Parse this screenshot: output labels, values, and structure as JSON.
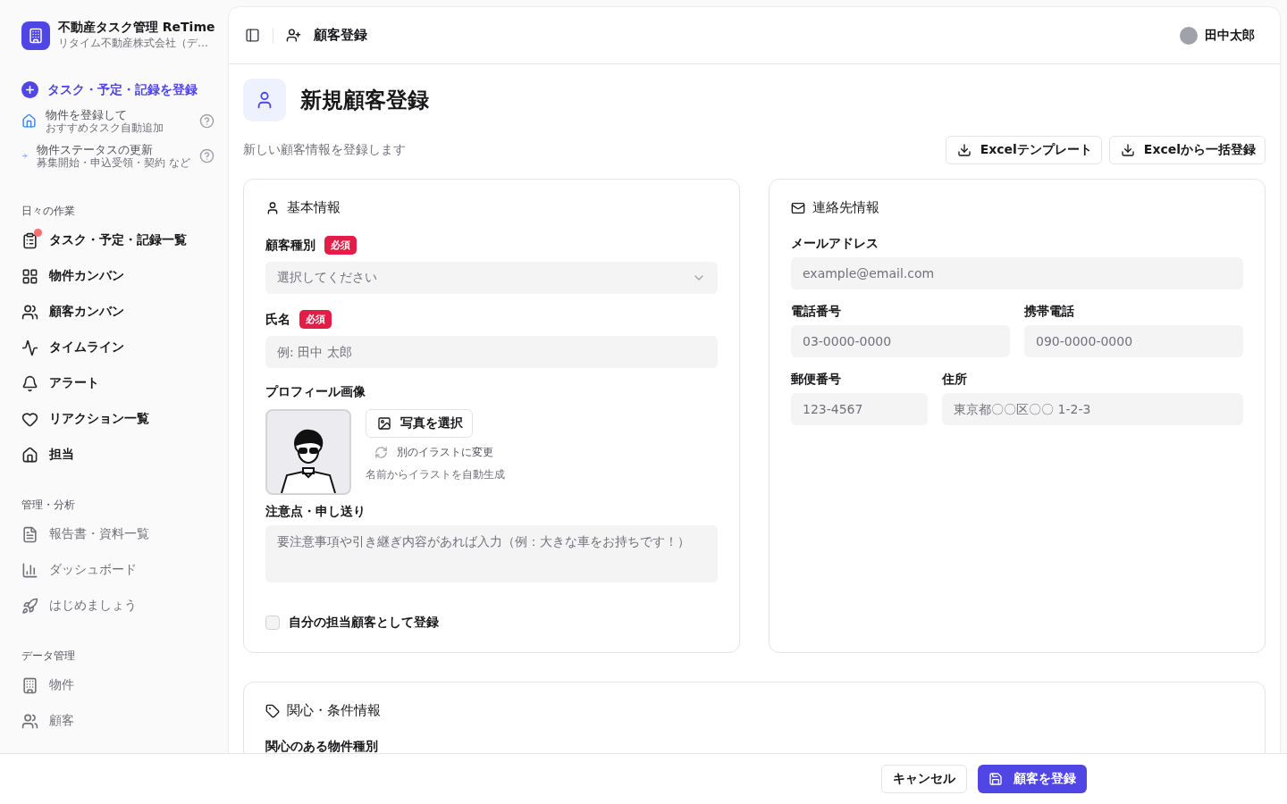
{
  "app": {
    "title": "不動産タスク管理 ReTime",
    "subtitle": "リタイム不動産株式会社（デ…"
  },
  "quick_actions": [
    {
      "kind": "primary",
      "label": "タスク・予定・記録を登録"
    },
    {
      "kind": "hint",
      "label": "物件を登録して",
      "sub": "おすすめタスク自動追加"
    },
    {
      "kind": "hint",
      "label": "物件ステータスの更新",
      "sub": "募集開始・申込受領・契約 など"
    }
  ],
  "sidebar": {
    "sections": [
      {
        "title": "日々の作業",
        "strong": true,
        "items": [
          {
            "label": "タスク・予定・記録一覧",
            "badge": true
          },
          {
            "label": "物件カンバン",
            "badge": false
          },
          {
            "label": "顧客カンバン",
            "badge": false
          },
          {
            "label": "タイムライン",
            "badge": false
          },
          {
            "label": "アラート",
            "badge": false
          },
          {
            "label": "リアクション一覧",
            "badge": false
          },
          {
            "label": "担当",
            "badge": false
          }
        ]
      },
      {
        "title": "管理・分析",
        "strong": false,
        "items": [
          {
            "label": "報告書・資料一覧",
            "badge": false
          },
          {
            "label": "ダッシュボード",
            "badge": false
          },
          {
            "label": "はじめましょう",
            "badge": false
          }
        ]
      },
      {
        "title": "データ管理",
        "strong": false,
        "items": [
          {
            "label": "物件",
            "badge": false
          },
          {
            "label": "顧客",
            "badge": false
          }
        ]
      }
    ]
  },
  "header": {
    "title": "顧客登録",
    "user": "田中太郎"
  },
  "page": {
    "title": "新規顧客登録",
    "description": "新しい顧客情報を登録します",
    "actions": [
      "Excelテンプレート",
      "Excelから一括登録"
    ]
  },
  "basic_info": {
    "title": "基本情報",
    "customer_type": {
      "label": "顧客種別",
      "required": "必須",
      "placeholder": "選択してください"
    },
    "name": {
      "label": "氏名",
      "required": "必須",
      "placeholder": "例: 田中 太郎"
    },
    "profile": {
      "label": "プロフィール画像",
      "choose": "写真を選択",
      "regenerate": "別のイラストに変更",
      "note": "名前からイラストを自動生成"
    },
    "notes": {
      "label": "注意点・申し送り",
      "placeholder": "要注意事項や引き継ぎ内容があれば入力（例：大きな車をお持ちです！）"
    },
    "assign_self": {
      "label": "自分の担当顧客として登録",
      "checked": false
    }
  },
  "contact_info": {
    "title": "連絡先情報",
    "fields": [
      [
        {
          "label": "メールアドレス",
          "placeholder": "example@email.com"
        }
      ],
      [
        {
          "label": "電話番号",
          "placeholder": "03-0000-0000"
        },
        {
          "label": "携帯電話",
          "placeholder": "090-0000-0000"
        }
      ],
      [
        {
          "label": "郵便番号",
          "placeholder": "123-4567"
        },
        {
          "label": "住所",
          "placeholder": "東京都〇〇区〇〇 1-2-3"
        }
      ]
    ]
  },
  "interest_info": {
    "title": "関心・条件情報",
    "subtitle": "関心のある物件種別"
  },
  "footer": {
    "cancel": "キャンセル",
    "submit": "顧客を登録"
  }
}
